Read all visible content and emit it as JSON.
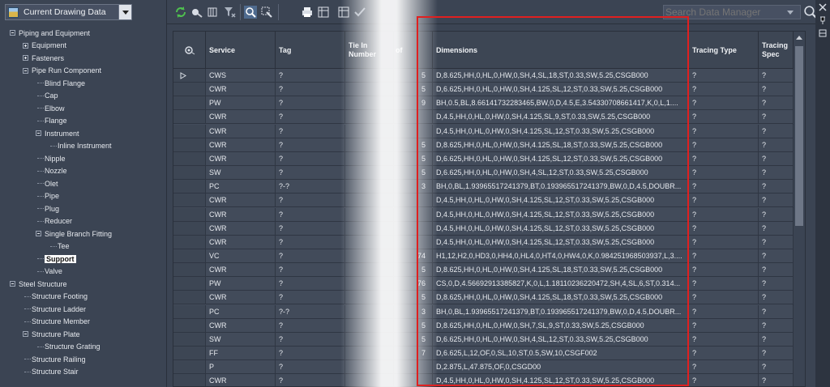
{
  "panel": {
    "dropdown_label": "Current Drawing Data"
  },
  "search": {
    "placeholder": "Search Data Manager"
  },
  "tree": [
    {
      "label": "Piping and Equipment",
      "depth": 0,
      "toggle": "minus"
    },
    {
      "label": "Equipment",
      "depth": 1,
      "toggle": "plus"
    },
    {
      "label": "Fasteners",
      "depth": 1,
      "toggle": "plus"
    },
    {
      "label": "Pipe Run Component",
      "depth": 1,
      "toggle": "minus"
    },
    {
      "label": "Blind Flange",
      "depth": 2
    },
    {
      "label": "Cap",
      "depth": 2
    },
    {
      "label": "Elbow",
      "depth": 2
    },
    {
      "label": "Flange",
      "depth": 2
    },
    {
      "label": "Instrument",
      "depth": 2,
      "toggle": "minus"
    },
    {
      "label": "Inline Instrument",
      "depth": 3
    },
    {
      "label": "Nipple",
      "depth": 2
    },
    {
      "label": "Nozzle",
      "depth": 2
    },
    {
      "label": "Olet",
      "depth": 2
    },
    {
      "label": "Pipe",
      "depth": 2
    },
    {
      "label": "Plug",
      "depth": 2
    },
    {
      "label": "Reducer",
      "depth": 2
    },
    {
      "label": "Single Branch Fitting",
      "depth": 2,
      "toggle": "minus"
    },
    {
      "label": "Tee",
      "depth": 3
    },
    {
      "label": "Support",
      "depth": 2,
      "selected": true
    },
    {
      "label": "Valve",
      "depth": 2
    },
    {
      "label": "Steel Structure",
      "depth": 0,
      "toggle": "minus"
    },
    {
      "label": "Structure Footing",
      "depth": 1
    },
    {
      "label": "Structure Ladder",
      "depth": 1
    },
    {
      "label": "Structure Member",
      "depth": 1
    },
    {
      "label": "Structure Plate",
      "depth": 1,
      "toggle": "minus"
    },
    {
      "label": "Structure Grating",
      "depth": 2
    },
    {
      "label": "Structure Railing",
      "depth": 1
    },
    {
      "label": "Structure Stair",
      "depth": 1
    }
  ],
  "columns": [
    "Service",
    "Tag",
    "Tie In Number",
    "of",
    "Dimensions",
    "Tracing Type",
    "Tracing Spec"
  ],
  "rows": [
    {
      "service": "CWS",
      "tag": "?",
      "num": "5",
      "dims": "D,8.625,HH,0,HL,0,HW,0,SH,4,SL,18,ST,0.33,SW,5.25,CSGB000",
      "tt": "?",
      "ts": "?"
    },
    {
      "service": "CWR",
      "tag": "?",
      "num": "5",
      "dims": "D,6.625,HH,0,HL,0,HW,0,SH,4.125,SL,12,ST,0.33,SW,5.25,CSGB000",
      "tt": "?",
      "ts": "?"
    },
    {
      "service": "PW",
      "tag": "?",
      "num": "9",
      "dims": "BH,0.5,BL,8.66141732283465,BW,0,D,4.5,E,3.54330708661417,K,0,L,1....",
      "tt": "?",
      "ts": "?"
    },
    {
      "service": "CWR",
      "tag": "?",
      "num": "",
      "dims": "D,4.5,HH,0,HL,0,HW,0,SH,4.125,SL,9,ST,0.33,SW,5.25,CSGB000",
      "tt": "?",
      "ts": "?"
    },
    {
      "service": "CWR",
      "tag": "?",
      "num": "",
      "dims": "D,4.5,HH,0,HL,0,HW,0,SH,4.125,SL,12,ST,0.33,SW,5.25,CSGB000",
      "tt": "?",
      "ts": "?"
    },
    {
      "service": "CWR",
      "tag": "?",
      "num": "5",
      "dims": "D,8.625,HH,0,HL,0,HW,0,SH,4.125,SL,18,ST,0.33,SW,5.25,CSGB000",
      "tt": "?",
      "ts": "?"
    },
    {
      "service": "CWR",
      "tag": "?",
      "num": "5",
      "dims": "D,6.625,HH,0,HL,0,HW,0,SH,4.125,SL,12,ST,0.33,SW,5.25,CSGB000",
      "tt": "?",
      "ts": "?"
    },
    {
      "service": "SW",
      "tag": "?",
      "num": "5",
      "dims": "D,6.625,HH,0,HL,0,HW,0,SH,4,SL,12,ST,0.33,SW,5.25,CSGB000",
      "tt": "?",
      "ts": "?"
    },
    {
      "service": "PC",
      "tag": "?-?",
      "num": "3",
      "dims": "BH,0,BL,1.93965517241379,BT,0.193965517241379,BW,0,D,4.5,DOUBR...",
      "tt": "?",
      "ts": "?"
    },
    {
      "service": "CWR",
      "tag": "?",
      "num": "",
      "dims": "D,4.5,HH,0,HL,0,HW,0,SH,4.125,SL,12,ST,0.33,SW,5.25,CSGB000",
      "tt": "?",
      "ts": "?"
    },
    {
      "service": "CWR",
      "tag": "?",
      "num": "",
      "dims": "D,4.5,HH,0,HL,0,HW,0,SH,4.125,SL,12,ST,0.33,SW,5.25,CSGB000",
      "tt": "?",
      "ts": "?"
    },
    {
      "service": "CWR",
      "tag": "?",
      "num": "",
      "dims": "D,4.5,HH,0,HL,0,HW,0,SH,4.125,SL,12,ST,0.33,SW,5.25,CSGB000",
      "tt": "?",
      "ts": "?"
    },
    {
      "service": "CWR",
      "tag": "?",
      "num": "",
      "dims": "D,4.5,HH,0,HL,0,HW,0,SH,4.125,SL,12,ST,0.33,SW,5.25,CSGB000",
      "tt": "?",
      "ts": "?"
    },
    {
      "service": "VC",
      "tag": "?",
      "num": "74",
      "dims": "H1,12,H2,0,HD3,0,HH4,0,HL4,0,HT4,0,HW4,0,K,0.984251968503937,L,3....",
      "tt": "?",
      "ts": "?"
    },
    {
      "service": "CWR",
      "tag": "?",
      "num": "5",
      "dims": "D,8.625,HH,0,HL,0,HW,0,SH,4.125,SL,18,ST,0.33,SW,5.25,CSGB000",
      "tt": "?",
      "ts": "?"
    },
    {
      "service": "PW",
      "tag": "?",
      "num": "76",
      "dims": "CS,0,D,4.56692913385827,K,0,L,1.18110236220472,SH,4,SL,6,ST,0.314...",
      "tt": "?",
      "ts": "?"
    },
    {
      "service": "CWR",
      "tag": "?",
      "num": "5",
      "dims": "D,8.625,HH,0,HL,0,HW,0,SH,4.125,SL,18,ST,0.33,SW,5.25,CSGB000",
      "tt": "?",
      "ts": "?"
    },
    {
      "service": "PC",
      "tag": "?-?",
      "num": "3",
      "dims": "BH,0,BL,1.93965517241379,BT,0.193965517241379,BW,0,D,4.5,DOUBR...",
      "tt": "?",
      "ts": "?"
    },
    {
      "service": "CWR",
      "tag": "?",
      "num": "5",
      "dims": "D,8.625,HH,0,HL,0,HW,0,SH,7,SL,9,ST,0.33,SW,5.25,CSGB000",
      "tt": "?",
      "ts": "?"
    },
    {
      "service": "SW",
      "tag": "?",
      "num": "5",
      "dims": "D,6.625,HH,0,HL,0,HW,0,SH,4,SL,12,ST,0.33,SW,5.25,CSGB000",
      "tt": "?",
      "ts": "?"
    },
    {
      "service": "FF",
      "tag": "?",
      "num": "7",
      "dims": "D,6.625,L,12,OF,0,SL,10,ST,0.5,SW,10,CSGF002",
      "tt": "?",
      "ts": "?"
    },
    {
      "service": "P",
      "tag": "?",
      "num": "",
      "dims": "D,2.875,L,47.875,OF,0,CSGD00",
      "tt": "?",
      "ts": "?"
    },
    {
      "service": "CWR",
      "tag": "?",
      "num": "",
      "dims": "D,4.5,HH,0,HL,0,HW,0,SH,4.125,SL,12,ST,0.33,SW,5.25,CSGB000",
      "tt": "?",
      "ts": "?"
    }
  ],
  "colors": {
    "highlight": "#e02020",
    "panel_bg": "#3b4453",
    "grid_bg": "#424b5a"
  },
  "icons": [
    "refresh-icon",
    "paint-icon",
    "filter-columns-icon",
    "filter-icon",
    "zoom-icon",
    "select-icon",
    "print-icon",
    "export-icon",
    "import-icon",
    "check-icon",
    "search-icon",
    "close-icon",
    "pin-icon",
    "settings-icon",
    "row-settings-icon",
    "current-row-arrow-icon"
  ]
}
